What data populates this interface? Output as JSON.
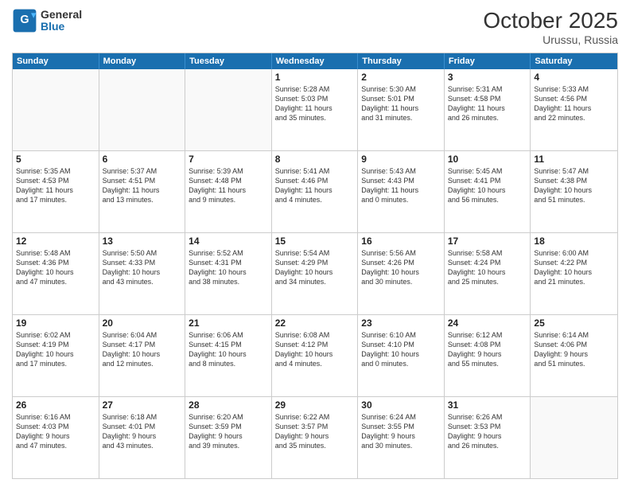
{
  "logo": {
    "general": "General",
    "blue": "Blue"
  },
  "title": "October 2025",
  "location": "Urussu, Russia",
  "days": [
    "Sunday",
    "Monday",
    "Tuesday",
    "Wednesday",
    "Thursday",
    "Friday",
    "Saturday"
  ],
  "rows": [
    [
      {
        "num": "",
        "text": "",
        "empty": true
      },
      {
        "num": "",
        "text": "",
        "empty": true
      },
      {
        "num": "",
        "text": "",
        "empty": true
      },
      {
        "num": "1",
        "text": "Sunrise: 5:28 AM\nSunset: 5:03 PM\nDaylight: 11 hours\nand 35 minutes."
      },
      {
        "num": "2",
        "text": "Sunrise: 5:30 AM\nSunset: 5:01 PM\nDaylight: 11 hours\nand 31 minutes."
      },
      {
        "num": "3",
        "text": "Sunrise: 5:31 AM\nSunset: 4:58 PM\nDaylight: 11 hours\nand 26 minutes."
      },
      {
        "num": "4",
        "text": "Sunrise: 5:33 AM\nSunset: 4:56 PM\nDaylight: 11 hours\nand 22 minutes."
      }
    ],
    [
      {
        "num": "5",
        "text": "Sunrise: 5:35 AM\nSunset: 4:53 PM\nDaylight: 11 hours\nand 17 minutes."
      },
      {
        "num": "6",
        "text": "Sunrise: 5:37 AM\nSunset: 4:51 PM\nDaylight: 11 hours\nand 13 minutes."
      },
      {
        "num": "7",
        "text": "Sunrise: 5:39 AM\nSunset: 4:48 PM\nDaylight: 11 hours\nand 9 minutes."
      },
      {
        "num": "8",
        "text": "Sunrise: 5:41 AM\nSunset: 4:46 PM\nDaylight: 11 hours\nand 4 minutes."
      },
      {
        "num": "9",
        "text": "Sunrise: 5:43 AM\nSunset: 4:43 PM\nDaylight: 11 hours\nand 0 minutes."
      },
      {
        "num": "10",
        "text": "Sunrise: 5:45 AM\nSunset: 4:41 PM\nDaylight: 10 hours\nand 56 minutes."
      },
      {
        "num": "11",
        "text": "Sunrise: 5:47 AM\nSunset: 4:38 PM\nDaylight: 10 hours\nand 51 minutes."
      }
    ],
    [
      {
        "num": "12",
        "text": "Sunrise: 5:48 AM\nSunset: 4:36 PM\nDaylight: 10 hours\nand 47 minutes."
      },
      {
        "num": "13",
        "text": "Sunrise: 5:50 AM\nSunset: 4:33 PM\nDaylight: 10 hours\nand 43 minutes."
      },
      {
        "num": "14",
        "text": "Sunrise: 5:52 AM\nSunset: 4:31 PM\nDaylight: 10 hours\nand 38 minutes."
      },
      {
        "num": "15",
        "text": "Sunrise: 5:54 AM\nSunset: 4:29 PM\nDaylight: 10 hours\nand 34 minutes."
      },
      {
        "num": "16",
        "text": "Sunrise: 5:56 AM\nSunset: 4:26 PM\nDaylight: 10 hours\nand 30 minutes."
      },
      {
        "num": "17",
        "text": "Sunrise: 5:58 AM\nSunset: 4:24 PM\nDaylight: 10 hours\nand 25 minutes."
      },
      {
        "num": "18",
        "text": "Sunrise: 6:00 AM\nSunset: 4:22 PM\nDaylight: 10 hours\nand 21 minutes."
      }
    ],
    [
      {
        "num": "19",
        "text": "Sunrise: 6:02 AM\nSunset: 4:19 PM\nDaylight: 10 hours\nand 17 minutes."
      },
      {
        "num": "20",
        "text": "Sunrise: 6:04 AM\nSunset: 4:17 PM\nDaylight: 10 hours\nand 12 minutes."
      },
      {
        "num": "21",
        "text": "Sunrise: 6:06 AM\nSunset: 4:15 PM\nDaylight: 10 hours\nand 8 minutes."
      },
      {
        "num": "22",
        "text": "Sunrise: 6:08 AM\nSunset: 4:12 PM\nDaylight: 10 hours\nand 4 minutes."
      },
      {
        "num": "23",
        "text": "Sunrise: 6:10 AM\nSunset: 4:10 PM\nDaylight: 10 hours\nand 0 minutes."
      },
      {
        "num": "24",
        "text": "Sunrise: 6:12 AM\nSunset: 4:08 PM\nDaylight: 9 hours\nand 55 minutes."
      },
      {
        "num": "25",
        "text": "Sunrise: 6:14 AM\nSunset: 4:06 PM\nDaylight: 9 hours\nand 51 minutes."
      }
    ],
    [
      {
        "num": "26",
        "text": "Sunrise: 6:16 AM\nSunset: 4:03 PM\nDaylight: 9 hours\nand 47 minutes."
      },
      {
        "num": "27",
        "text": "Sunrise: 6:18 AM\nSunset: 4:01 PM\nDaylight: 9 hours\nand 43 minutes."
      },
      {
        "num": "28",
        "text": "Sunrise: 6:20 AM\nSunset: 3:59 PM\nDaylight: 9 hours\nand 39 minutes."
      },
      {
        "num": "29",
        "text": "Sunrise: 6:22 AM\nSunset: 3:57 PM\nDaylight: 9 hours\nand 35 minutes."
      },
      {
        "num": "30",
        "text": "Sunrise: 6:24 AM\nSunset: 3:55 PM\nDaylight: 9 hours\nand 30 minutes."
      },
      {
        "num": "31",
        "text": "Sunrise: 6:26 AM\nSunset: 3:53 PM\nDaylight: 9 hours\nand 26 minutes."
      },
      {
        "num": "",
        "text": "",
        "empty": true
      }
    ]
  ]
}
